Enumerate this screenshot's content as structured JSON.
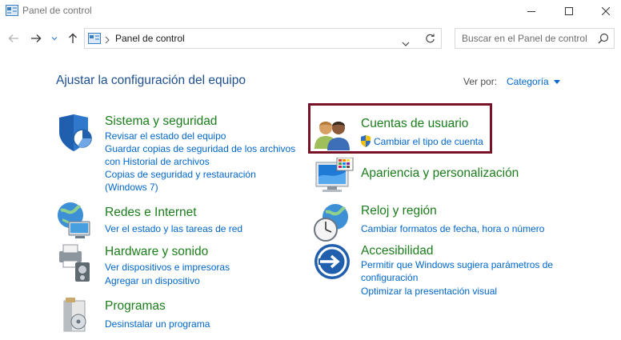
{
  "window": {
    "title": "Panel de control"
  },
  "navigation": {
    "address": "Panel de control",
    "search_placeholder": "Buscar en el Panel de control"
  },
  "main": {
    "title": "Ajustar la configuración del equipo",
    "view_by_label": "Ver por:",
    "view_by_value": "Categoría"
  },
  "categories": [
    {
      "title": "Sistema y seguridad",
      "links": [
        "Revisar el estado del equipo",
        "Guardar copias de seguridad de los archivos",
        "con Historial de archivos",
        "Copias de seguridad y restauración",
        "(Windows 7)"
      ]
    },
    {
      "title": "Redes e Internet",
      "links": [
        "Ver el estado y las tareas de red"
      ]
    },
    {
      "title": "Hardware y sonido",
      "links": [
        "Ver dispositivos e impresoras",
        "Agregar un dispositivo"
      ]
    },
    {
      "title": "Programas",
      "links": [
        "Desinstalar un programa"
      ]
    },
    {
      "title": "Cuentas de usuario",
      "links": [
        "Cambiar el tipo de cuenta"
      ]
    },
    {
      "title": "Apariencia y personalización",
      "links": []
    },
    {
      "title": "Reloj y región",
      "links": [
        "Cambiar formatos de fecha, hora o número"
      ]
    },
    {
      "title": "Accesibilidad",
      "links": [
        "Permitir que Windows sugiera parámetros de",
        "configuración",
        "Optimizar la presentación visual"
      ]
    }
  ],
  "colors": {
    "category_title": "#1b7d1b",
    "link": "#0066cc",
    "highlight_border": "#7a1227"
  }
}
